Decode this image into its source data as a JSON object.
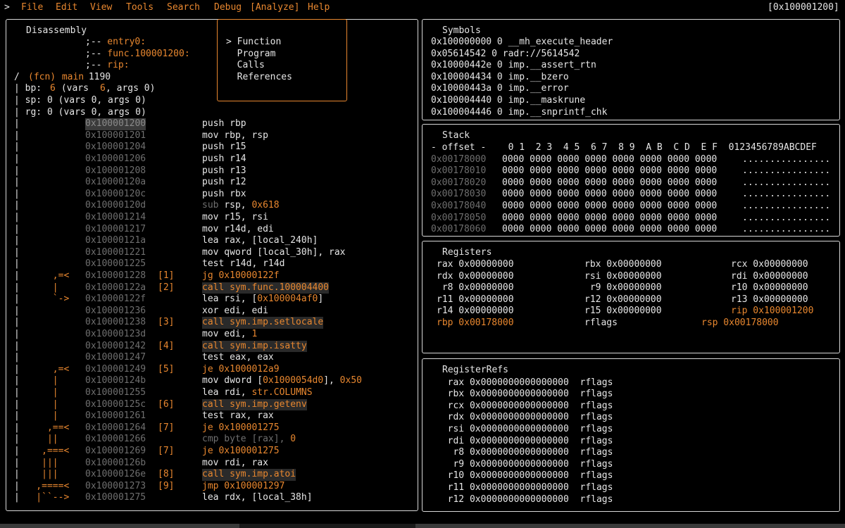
{
  "menubar": {
    "prompt": ">",
    "items": [
      "File",
      "Edit",
      "View",
      "Tools",
      "Search",
      "Debug",
      "[Analyze]",
      "Help"
    ],
    "address": "[0x100001200]"
  },
  "dropdown": {
    "items": [
      "> Function",
      "  Program",
      "  Calls",
      "  References"
    ]
  },
  "disasm": {
    "title": "Disassembly",
    "flags": [
      ";-- entry0:",
      ";-- func.100001200:",
      ";-- rip:"
    ],
    "fcn": {
      "prefix": "/ ",
      "label": "(fcn)",
      "name": " main",
      "size": " 1190"
    },
    "vars": [
      {
        "pre": "| bp: ",
        "n": "6",
        "mid": " (vars ",
        "v": "6",
        "post": ", args 0)"
      },
      {
        "pre": "| sp: 0 (vars 0, args 0)",
        "n": "",
        "mid": "",
        "v": "",
        "post": ""
      },
      {
        "pre": "| rg: 0 (vars 0, args 0)",
        "n": "",
        "mid": "",
        "v": "",
        "post": ""
      }
    ],
    "rows": [
      {
        "g": "|",
        "addr": "0x100001200",
        "ref": "",
        "op": "push rbp"
      },
      {
        "g": "|",
        "addr": "0x100001201",
        "ref": "",
        "op": "mov rbp, rsp"
      },
      {
        "g": "|",
        "addr": "0x100001204",
        "ref": "",
        "op": "push r15"
      },
      {
        "g": "|",
        "addr": "0x100001206",
        "ref": "",
        "op": "push r14"
      },
      {
        "g": "|",
        "addr": "0x100001208",
        "ref": "",
        "op": "push r13"
      },
      {
        "g": "|",
        "addr": "0x10000120a",
        "ref": "",
        "op": "push r12"
      },
      {
        "g": "|",
        "addr": "0x10000120c",
        "ref": "",
        "op": "push rbx"
      },
      {
        "g": "|",
        "addr": "0x10000120d",
        "ref": "",
        "op": "sub rsp, 0x618"
      },
      {
        "g": "|",
        "addr": "0x100001214",
        "ref": "",
        "op": "mov r15, rsi"
      },
      {
        "g": "|",
        "addr": "0x100001217",
        "ref": "",
        "op": "mov r14d, edi"
      },
      {
        "g": "|",
        "addr": "0x10000121a",
        "ref": "",
        "op": "lea rax, [local_240h]"
      },
      {
        "g": "|",
        "addr": "0x100001221",
        "ref": "",
        "op": "mov qword [local_30h], rax"
      },
      {
        "g": "|",
        "addr": "0x100001225",
        "ref": "",
        "op": "test r14d, r14d"
      },
      {
        "g": "|      ,=< ",
        "addr": "0x100001228",
        "ref": "[1]",
        "op": "jg 0x10000122f"
      },
      {
        "g": "|      | ",
        "addr": "0x10000122a",
        "ref": "[2]",
        "op": "call sym.func.100004400"
      },
      {
        "g": "|      `-> ",
        "addr": "0x10000122f",
        "ref": "",
        "op": "lea rsi, [0x100004af0]"
      },
      {
        "g": "|",
        "addr": "0x100001236",
        "ref": "",
        "op": "xor edi, edi"
      },
      {
        "g": "|",
        "addr": "0x100001238",
        "ref": "[3]",
        "op": "call sym.imp.setlocale"
      },
      {
        "g": "|",
        "addr": "0x10000123d",
        "ref": "",
        "op": "mov edi, 1"
      },
      {
        "g": "|",
        "addr": "0x100001242",
        "ref": "[4]",
        "op": "call sym.imp.isatty"
      },
      {
        "g": "|",
        "addr": "0x100001247",
        "ref": "",
        "op": "test eax, eax"
      },
      {
        "g": "|      ,=< ",
        "addr": "0x100001249",
        "ref": "[5]",
        "op": "je 0x1000012a9"
      },
      {
        "g": "|      | ",
        "addr": "0x10000124b",
        "ref": "",
        "op": "mov dword [0x1000054d0], 0x50"
      },
      {
        "g": "|      | ",
        "addr": "0x100001255",
        "ref": "",
        "op": "lea rdi, str.COLUMNS"
      },
      {
        "g": "|      | ",
        "addr": "0x10000125c",
        "ref": "[6]",
        "op": "call sym.imp.getenv"
      },
      {
        "g": "|      | ",
        "addr": "0x100001261",
        "ref": "",
        "op": "test rax, rax"
      },
      {
        "g": "|     ,==< ",
        "addr": "0x100001264",
        "ref": "[7]",
        "op": "je 0x100001275"
      },
      {
        "g": "|     || ",
        "addr": "0x100001266",
        "ref": "",
        "op": "cmp byte [rax], 0"
      },
      {
        "g": "|    ,===< ",
        "addr": "0x100001269",
        "ref": "[7]",
        "op": "je 0x100001275"
      },
      {
        "g": "|    ||| ",
        "addr": "0x10000126b",
        "ref": "",
        "op": "mov rdi, rax"
      },
      {
        "g": "|    ||| ",
        "addr": "0x10000126e",
        "ref": "[8]",
        "op": "call sym.imp.atoi"
      },
      {
        "g": "|   ,====< ",
        "addr": "0x100001273",
        "ref": "[9]",
        "op": "jmp 0x100001297"
      },
      {
        "g": "|   |``--> ",
        "addr": "0x100001275",
        "ref": "",
        "op": "lea rdx, [local_38h]"
      }
    ]
  },
  "symbols": {
    "title": "Symbols",
    "rows": [
      "0x100000000 0 __mh_execute_header",
      "0x05614542 0 radr://5614542",
      "0x10000442e 0 imp.__assert_rtn",
      "0x100004434 0 imp.__bzero",
      "0x10000443a 0 imp.__error",
      "0x100004440 0 imp.__maskrune",
      "0x100004446 0 imp.__snprintf_chk"
    ]
  },
  "stack": {
    "title": "Stack",
    "header": "- offset -    0 1  2 3  4 5  6 7  8 9  A B  C D  E F  0123456789ABCDEF",
    "rows": [
      {
        "off": "0x00178000",
        "hex": "0000 0000 0000 0000 0000 0000 0000 0000",
        "asc": "................"
      },
      {
        "off": "0x00178010",
        "hex": "0000 0000 0000 0000 0000 0000 0000 0000",
        "asc": "................"
      },
      {
        "off": "0x00178020",
        "hex": "0000 0000 0000 0000 0000 0000 0000 0000",
        "asc": "................"
      },
      {
        "off": "0x00178030",
        "hex": "0000 0000 0000 0000 0000 0000 0000 0000",
        "asc": "................"
      },
      {
        "off": "0x00178040",
        "hex": "0000 0000 0000 0000 0000 0000 0000 0000",
        "asc": "................"
      },
      {
        "off": "0x00178050",
        "hex": "0000 0000 0000 0000 0000 0000 0000 0000",
        "asc": "................"
      },
      {
        "off": "0x00178060",
        "hex": "0000 0000 0000 0000 0000 0000 0000 0000",
        "asc": "................"
      }
    ]
  },
  "registers": {
    "title": "Registers",
    "rows": [
      [
        {
          "t": "rax 0x00000000"
        },
        {
          "t": "rbx 0x00000000"
        },
        {
          "t": "rcx 0x00000000"
        }
      ],
      [
        {
          "t": "rdx 0x00000000"
        },
        {
          "t": "rsi 0x00000000"
        },
        {
          "t": "rdi 0x00000000"
        }
      ],
      [
        {
          "t": " r8 0x00000000"
        },
        {
          "t": " r9 0x00000000"
        },
        {
          "t": "r10 0x00000000"
        }
      ],
      [
        {
          "t": "r11 0x00000000"
        },
        {
          "t": "r12 0x00000000"
        },
        {
          "t": "r13 0x00000000"
        }
      ],
      [
        {
          "t": "r14 0x00000000"
        },
        {
          "t": "r15 0x00000000"
        },
        {
          "t": "rip 0x100001200",
          "hi": true
        }
      ],
      [
        {
          "t": "rbp 0x00178000",
          "hi": true
        },
        {
          "t": "rflags"
        },
        {
          "t": "rsp 0x00178000",
          "hi": true
        }
      ]
    ]
  },
  "registerrefs": {
    "title": "RegisterRefs",
    "rows": [
      "  rax 0x0000000000000000  rflags",
      "  rbx 0x0000000000000000  rflags",
      "  rcx 0x0000000000000000  rflags",
      "  rdx 0x0000000000000000  rflags",
      "  rsi 0x0000000000000000  rflags",
      "  rdi 0x0000000000000000  rflags",
      "   r8 0x0000000000000000  rflags",
      "   r9 0x0000000000000000  rflags",
      "  r10 0x0000000000000000  rflags",
      "  r11 0x0000000000000000  rflags",
      "  r12 0x0000000000000000  rflags"
    ]
  },
  "colors": {
    "accent": "#e8872f",
    "text": "#e6e6e6",
    "dim": "#6f6f6f",
    "border": "#d8d8d8"
  }
}
